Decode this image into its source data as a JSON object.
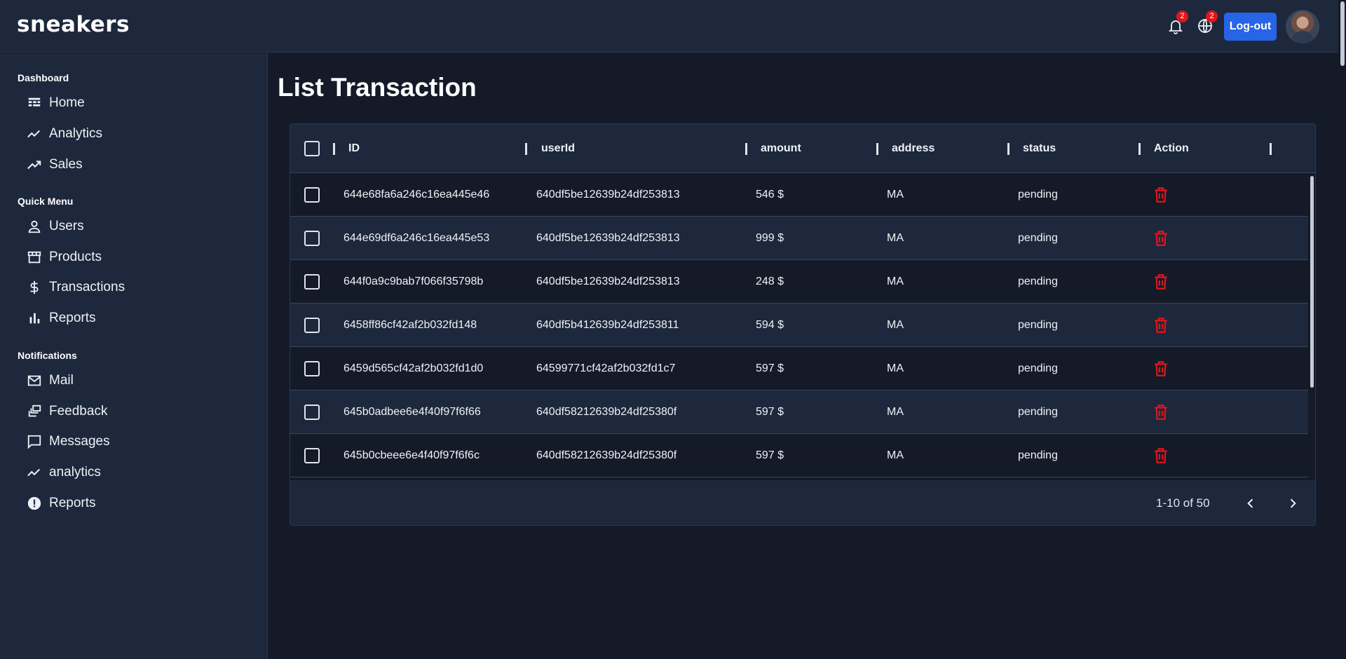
{
  "app": {
    "logo": "sneakers"
  },
  "header": {
    "notifications_badge": "2",
    "language_badge": "2",
    "logout_label": "Log-out"
  },
  "sidebar": {
    "sections": [
      {
        "title": "Dashboard",
        "items": [
          {
            "label": "Home",
            "icon": "dashboard-icon"
          },
          {
            "label": "Analytics",
            "icon": "timeline-icon"
          },
          {
            "label": "Sales",
            "icon": "trending-up-icon"
          }
        ]
      },
      {
        "title": "Quick Menu",
        "items": [
          {
            "label": "Users",
            "icon": "person-icon"
          },
          {
            "label": "Products",
            "icon": "storefront-icon"
          },
          {
            "label": "Transactions",
            "icon": "dollar-icon"
          },
          {
            "label": "Reports",
            "icon": "bar-chart-icon"
          }
        ]
      },
      {
        "title": "Notifications",
        "items": [
          {
            "label": "Mail",
            "icon": "mail-icon"
          },
          {
            "label": "Feedback",
            "icon": "dynamic-feed-icon"
          },
          {
            "label": "Messages",
            "icon": "chat-bubble-icon"
          },
          {
            "label": "analytics",
            "icon": "timeline-icon"
          },
          {
            "label": "Reports",
            "icon": "report-icon"
          }
        ]
      }
    ]
  },
  "main": {
    "title": "List Transaction",
    "columns": [
      "ID",
      "userId",
      "amount",
      "address",
      "status",
      "Action"
    ],
    "rows": [
      {
        "id": "644e68fa6a246c16ea445e46",
        "userId": "640df5be12639b24df253813",
        "amount": "546 $",
        "address": "MA",
        "status": "pending"
      },
      {
        "id": "644e69df6a246c16ea445e53",
        "userId": "640df5be12639b24df253813",
        "amount": "999 $",
        "address": "MA",
        "status": "pending"
      },
      {
        "id": "644f0a9c9bab7f066f35798b",
        "userId": "640df5be12639b24df253813",
        "amount": "248 $",
        "address": "MA",
        "status": "pending"
      },
      {
        "id": "6458ff86cf42af2b032fd148",
        "userId": "640df5b412639b24df253811",
        "amount": "594 $",
        "address": "MA",
        "status": "pending"
      },
      {
        "id": "6459d565cf42af2b032fd1d0",
        "userId": "64599771cf42af2b032fd1c7",
        "amount": "597 $",
        "address": "MA",
        "status": "pending"
      },
      {
        "id": "645b0adbee6e4f40f97f6f66",
        "userId": "640df58212639b24df25380f",
        "amount": "597 $",
        "address": "MA",
        "status": "pending"
      },
      {
        "id": "645b0cbeee6e4f40f97f6f6c",
        "userId": "640df58212639b24df25380f",
        "amount": "597 $",
        "address": "MA",
        "status": "pending"
      }
    ],
    "pagination": {
      "label": "1-10 of 50"
    }
  },
  "colors": {
    "background": "#141a28",
    "panel": "#1e283c",
    "accent": "#2764e8",
    "danger": "#e0161b"
  }
}
